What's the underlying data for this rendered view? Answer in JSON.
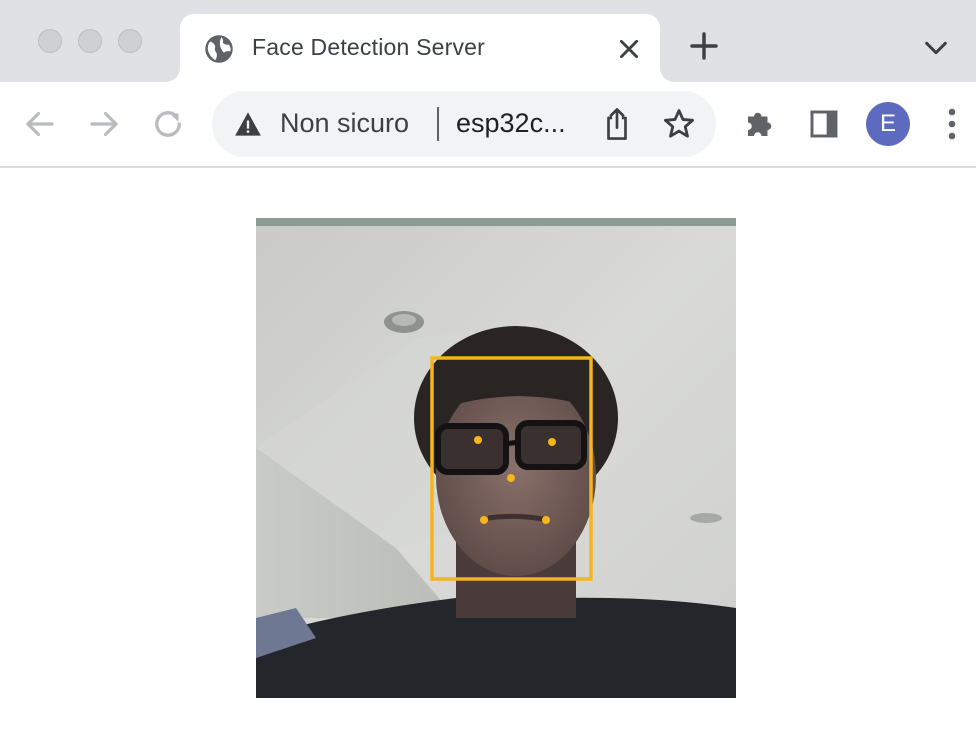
{
  "window": {
    "controls": [
      "close-button",
      "minimize-button",
      "zoom-button"
    ]
  },
  "tab": {
    "title": "Face Detection Server",
    "favicon": "globe-icon",
    "close_icon": "close-icon"
  },
  "tabstrip": {
    "new_tab_icon": "plus-icon",
    "tab_search_icon": "chevron-down-icon"
  },
  "toolbar": {
    "back_icon": "arrow-left-icon",
    "forward_icon": "arrow-right-icon",
    "reload_icon": "reload-icon",
    "security_label": "Non sicuro",
    "security_icon": "warning-triangle-icon",
    "url": "esp32c...",
    "share_icon": "share-icon",
    "bookmark_icon": "star-icon",
    "extensions_icon": "puzzle-icon",
    "side_panel_icon": "side-panel-icon",
    "profile_initial": "E",
    "menu_icon": "more-vert-icon"
  },
  "colors": {
    "tabstrip_bg": "#dfe1e5",
    "omnibox_bg": "#f1f3f4",
    "avatar_bg": "#5c6bc0",
    "detection_box": "#f5b51b"
  },
  "content": {
    "stream_icon": "camera-stream-image",
    "detections": [
      {
        "label": "face",
        "landmarks": [
          "left-eye",
          "right-eye",
          "nose",
          "mouth-left",
          "mouth-right"
        ]
      }
    ]
  }
}
